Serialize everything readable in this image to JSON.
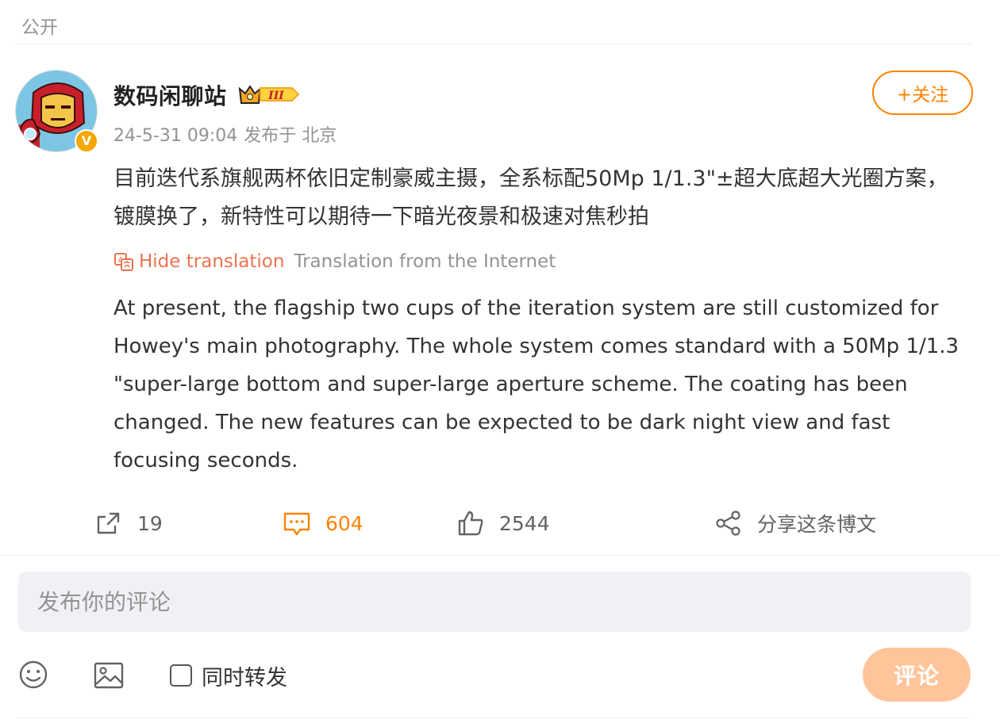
{
  "visibility": "公开",
  "author": {
    "name": "数码闲聊站",
    "avatar": "iron-man-avatar",
    "verified_badge": "V",
    "level_badge": "crown-level-III",
    "level_text": "III"
  },
  "meta": {
    "timestamp": "24-5-31 09:04",
    "location": "发布于 北京"
  },
  "follow_label": "+关注",
  "post": {
    "text": "目前迭代系旗舰两杯依旧定制豪威主摄，全系标配50Mp 1/1.3\"±超大底超大光圈方案，镀膜换了，新特性可以期待一下暗光夜景和极速对焦秒拍"
  },
  "translation": {
    "hide_label": "Hide translation",
    "source_label": "Translation from the Internet",
    "text": "At present, the flagship two cups of the iteration system are still customized for Howey's main photography. The whole system comes standard with a 50Mp 1/1.3 \"super-large bottom and super-large aperture scheme. The coating has been changed. The new features can be expected to be dark night view and fast focusing seconds."
  },
  "actions": {
    "repost_count": "19",
    "comment_count": "604",
    "like_count": "2544",
    "share_label": "分享这条博文"
  },
  "comment_box": {
    "placeholder": "发布你的评论",
    "value": "",
    "repost_label": "同时转发",
    "repost_checked": false,
    "submit_label": "评论"
  },
  "colors": {
    "accent": "#ff8200",
    "translation_link": "#eb7350",
    "muted": "#939393",
    "submit_disabled": "#ffc59a",
    "input_bg": "#f0f1f4"
  }
}
